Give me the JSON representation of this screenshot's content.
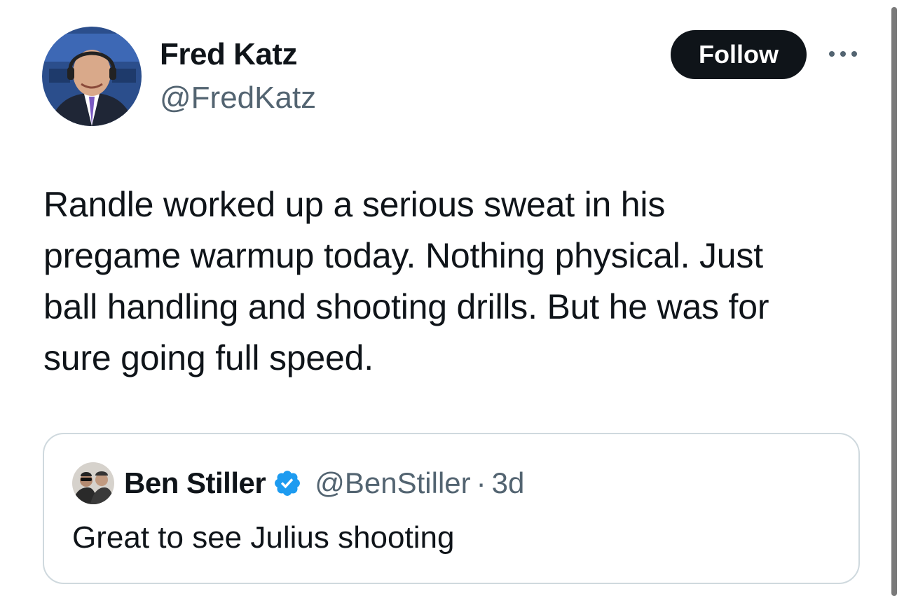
{
  "author": {
    "name": "Fred Katz",
    "handle": "@FredKatz",
    "avatar_icon": "person-photo-avatar"
  },
  "actions": {
    "follow_label": "Follow",
    "more_icon": "more-options-icon"
  },
  "tweet": {
    "text": "Randle worked up a serious sweat in his\npregame warmup today. Nothing physical. Just\nball handling and shooting drills. But he was for\nsure going full speed."
  },
  "quoted_tweet": {
    "name": "Ben Stiller",
    "verified_icon": "verified-badge-icon",
    "handle": "@BenStiller",
    "separator": "·",
    "time": "3d",
    "text": "Great to see Julius shooting"
  },
  "colors": {
    "text_primary": "#0f1419",
    "text_secondary": "#536471",
    "follow_bg": "#0f1419",
    "border": "#cfd9de",
    "verified": "#1d9bf0"
  }
}
